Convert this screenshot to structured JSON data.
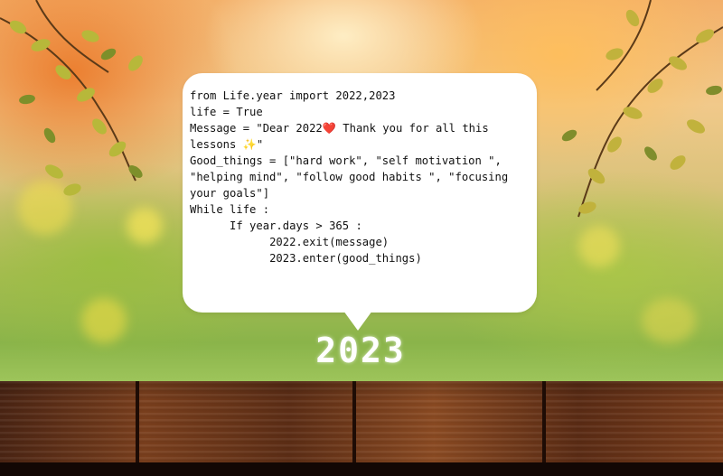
{
  "code_lines": [
    "from Life.year import 2022,2023",
    "life = True",
    "Message = \"Dear 2022",
    "❤️",
    " Thank you for all this lessons ",
    "✨",
    "\"",
    "Good_things = [\"hard work\", \"self motivation \", \"helping mind\", \"follow good habits \", \"focusing your goals\"]",
    "While life :",
    "      If year.days > 365 :",
    "            2022.exit(message)",
    "            2023.enter(good_things)"
  ],
  "year_label": "2023"
}
